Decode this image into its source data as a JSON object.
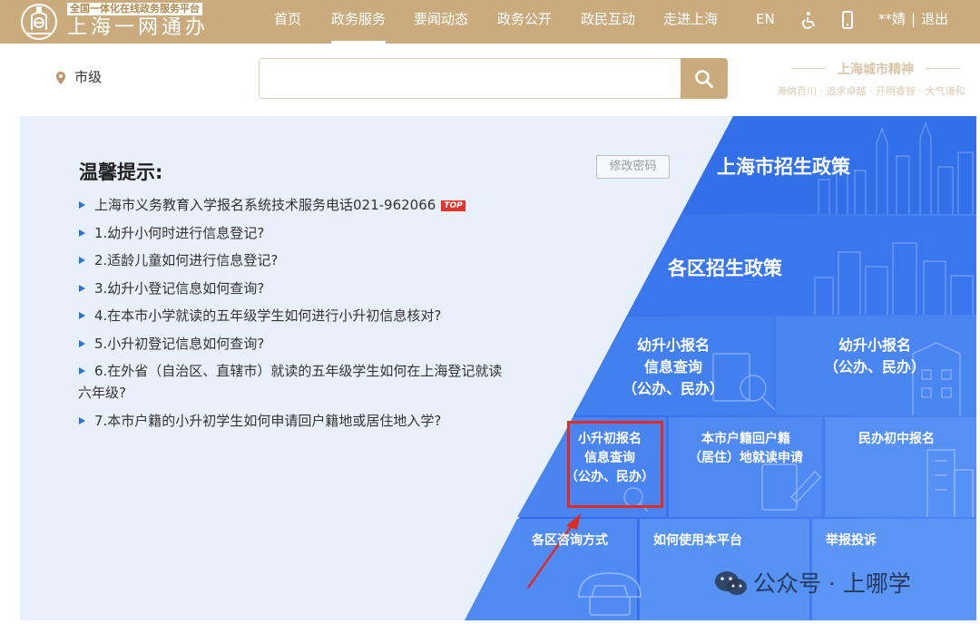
{
  "header": {
    "platform_tag": "全国一体化在线政务服务平台",
    "brand": "上海一网通办",
    "nav": [
      "首页",
      "政务服务",
      "要闻动态",
      "政务公开",
      "政民互动",
      "走进上海",
      "EN"
    ],
    "active_nav": "政务服务",
    "user_name": "**婧",
    "user_separator": "|",
    "logout": "退出"
  },
  "search": {
    "location": "市级",
    "placeholder": ""
  },
  "slogan": {
    "title": "上海城市精神",
    "subtitle": "海纳百川 · 追求卓越 · 开明睿智 · 大气谦和"
  },
  "tips": {
    "title": "温馨提示:",
    "change_password": "修改密码",
    "items": [
      "上海市义务教育入学报名系统技术服务电话021-962066",
      "1.幼升小何时进行信息登记?",
      "2.适龄儿童如何进行信息登记?",
      "3.幼升小登记信息如何查询?",
      "4.在本市小学就读的五年级学生如何进行小升初信息核对?",
      "5.小升初登记信息如何查询?",
      "6.在外省（自治区、直辖市）就读的五年级学生如何在上海登记就读六年级?",
      "7.本市户籍的小升初学生如何申请回户籍地或居住地入学?"
    ],
    "top_badge": "TOP"
  },
  "tiles": {
    "city_policy": "上海市招生政策",
    "district_policy": "各区招生政策",
    "kinder_query": [
      "幼升小报名",
      "信息查询",
      "（公办、民办）"
    ],
    "kinder_signup": [
      "幼升小报名",
      "（公办、民办）"
    ],
    "primary_query": [
      "小升初报名",
      "信息查询",
      "（公办、民办）"
    ],
    "hukou_apply": [
      "本市户籍回户籍",
      "（居住）地就读申请"
    ],
    "private_middle": "民办初中报名",
    "district_contact": "各区咨询方式",
    "how_to_use": "如何使用本平台",
    "complaint": "举报投诉"
  },
  "watermark": {
    "text": "公众号 · 上哪学"
  },
  "colors": {
    "header_gold": "#c9ab7e",
    "panel_bg": "#e8f0fb",
    "tile_blue": "#3e7bf0",
    "tile_blue_dark": "#2f65e2",
    "highlight_red": "#e02a22"
  }
}
